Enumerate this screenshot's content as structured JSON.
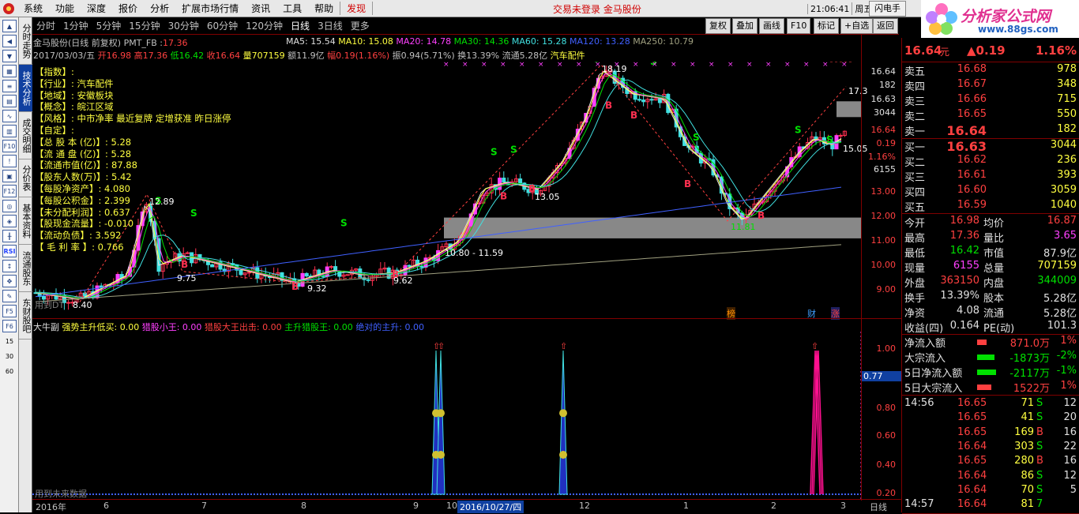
{
  "menu": [
    "系统",
    "功能",
    "深度",
    "报价",
    "分析",
    "扩展市场行情",
    "资讯",
    "工具",
    "帮助"
  ],
  "menu_find": "发现",
  "status_center": "交易未登录   金马股份",
  "clock": {
    "time": "21:06:41",
    "weekday": "周五"
  },
  "flash": "闪电手",
  "brand": {
    "name": "分析家公式网",
    "url": "www.88gs.com"
  },
  "vtabs": [
    "分时走势",
    "技术分析",
    "成交明细",
    "分价表",
    "基本资料",
    "流通股东",
    "东财股吧"
  ],
  "timeframes": [
    "分时",
    "1分钟",
    "5分钟",
    "15分钟",
    "30分钟",
    "60分钟",
    "120分钟",
    "日线",
    "3日线",
    "更多"
  ],
  "toolbar": [
    "复权",
    "叠加",
    "画线",
    "F10",
    "标记",
    "+自选",
    "返回"
  ],
  "info": {
    "title": "金马股份(日线 前复权) PMT_FB :",
    "title_val": "17.36",
    "ma": [
      {
        "l": "MA5: 15.54",
        "c": "#e0e0e0"
      },
      {
        "l": "MA10: 15.08",
        "c": "#ffff40"
      },
      {
        "l": "MA20: 14.78",
        "c": "#ff40ff"
      },
      {
        "l": "MA30: 14.36",
        "c": "#00e000"
      },
      {
        "l": "MA60: 15.28",
        "c": "#40e0e0"
      },
      {
        "l": "MA120: 13.28",
        "c": "#4060ff"
      },
      {
        "l": "MA250: 10.79",
        "c": "#a0a080"
      }
    ],
    "line2": [
      {
        "t": "2017/03/03/五 ",
        "c": "#c0c0c0"
      },
      {
        "t": "开16.98 ",
        "c": "#ff4040"
      },
      {
        "t": "高17.36 ",
        "c": "#ff4040"
      },
      {
        "t": "低16.42 ",
        "c": "#00e000"
      },
      {
        "t": "收16.64 ",
        "c": "#ff4040"
      },
      {
        "t": "量707159 ",
        "c": "#ffff40"
      },
      {
        "t": "额11.9亿 ",
        "c": "#c0c0c0"
      },
      {
        "t": "幅0.19(1.16%) ",
        "c": "#ff4040"
      },
      {
        "t": "振0.94(5.71%) ",
        "c": "#c0c0c0"
      },
      {
        "t": "换13.39% ",
        "c": "#c0c0c0"
      },
      {
        "t": "流通5.28亿 ",
        "c": "#c0c0c0"
      },
      {
        "t": "汽车配件",
        "c": "#ffff40"
      }
    ]
  },
  "fin": [
    "【指数】:",
    "【行业】: 汽车配件",
    "【地域】: 安徽板块",
    "【概念】: 皖江区域",
    "【风格】: 中市净率 最近复牌 定增获准 昨日涨停",
    "【自定】:",
    "【总 股 本 (亿)】: 5.28",
    "【流 通 盘 (亿)】: 5.28",
    "【流通市值(亿)】: 87.88",
    "【股东人数(万)】: 5.42",
    "【每股净资产】: 4.080",
    "【每股公积金】: 2.399",
    "【未分配利润】: 0.637",
    "【股现金流量】: -0.010",
    "【流动负债】: 3.592",
    "【 毛 利 率 】: 0.766"
  ],
  "chart_labels": {
    "p1289": "12.89",
    "p975": "9.75",
    "p932": "9.32",
    "p962": "9.62",
    "p1080": "10.80 - 11.59",
    "p1305": "13.05",
    "p1819": "18.19",
    "p1181": "11.81",
    "p1505": "15.05",
    "p173": "17.3",
    "p840": "8.40",
    "use": "用到DT",
    "future": "用到未来数据"
  },
  "price_axis": [
    "16.64",
    "182",
    "16.63",
    "3044",
    "16.64",
    "0.19",
    "1.16%",
    "6155",
    "13.00",
    "12.00",
    "11.00",
    "10.00",
    "9.00"
  ],
  "sub_axis": [
    "1.00",
    "0.80",
    "0.77",
    "0.60",
    "0.40",
    "0.20"
  ],
  "legend": [
    {
      "t": "大牛副 ",
      "c": "#e0e0e0"
    },
    {
      "t": "强势主升低买: 0.00  ",
      "c": "#ffff40"
    },
    {
      "t": "猎股小王: 0.00  ",
      "c": "#ff40ff"
    },
    {
      "t": "猎股大王出击: 0.00  ",
      "c": "#ff4040"
    },
    {
      "t": "主升猎股王: 0.00  ",
      "c": "#00e000"
    },
    {
      "t": "绝对的主升: 0.00",
      "c": "#4060ff"
    }
  ],
  "xaxis": [
    "2016年",
    "6",
    "7",
    "8",
    "9",
    "10",
    "2016/10/27/四",
    "12",
    "1",
    "2",
    "3",
    "日线"
  ],
  "events": [
    "榜",
    "财",
    "涨"
  ],
  "quote": {
    "price": "16.64",
    "unit": "元",
    "chg": "▲0.19",
    "pct": "1.16%"
  },
  "asks": [
    {
      "l": "卖五",
      "p": "16.68",
      "v": "978"
    },
    {
      "l": "卖四",
      "p": "16.67",
      "v": "348"
    },
    {
      "l": "卖三",
      "p": "16.66",
      "v": "715"
    },
    {
      "l": "卖二",
      "p": "16.65",
      "v": "550"
    },
    {
      "l": "卖一",
      "p": "16.64",
      "v": "182"
    }
  ],
  "bids": [
    {
      "l": "买一",
      "p": "16.63",
      "v": "3044"
    },
    {
      "l": "买二",
      "p": "16.62",
      "v": "236"
    },
    {
      "l": "买三",
      "p": "16.61",
      "v": "393"
    },
    {
      "l": "买四",
      "p": "16.60",
      "v": "3059"
    },
    {
      "l": "买五",
      "p": "16.59",
      "v": "1040"
    }
  ],
  "stats": [
    [
      "今开",
      "16.98",
      "均价",
      "16.87"
    ],
    [
      "最高",
      "17.36",
      "量比",
      "3.65"
    ],
    [
      "最低",
      "16.42",
      "市值",
      "87.9亿"
    ],
    [
      "现量",
      "6155",
      "总量",
      "707159"
    ],
    [
      "外盘",
      "363150",
      "内盘",
      "344009"
    ],
    [
      "换手",
      "13.39%",
      "股本",
      "5.28亿"
    ],
    [
      "净资",
      "4.08",
      "流通",
      "5.28亿"
    ],
    [
      "收益(四)",
      "0.164",
      "PE(动)",
      "101.3"
    ]
  ],
  "flows": [
    {
      "l": "净流入额",
      "v": "871.0万",
      "p": "1%"
    },
    {
      "l": "大宗流入",
      "v": "-1873万",
      "p": "-2%"
    },
    {
      "l": "5日净流入额",
      "v": "-2117万",
      "p": "-1%"
    },
    {
      "l": "5日大宗流入",
      "v": "1522万",
      "p": "1%"
    }
  ],
  "ticks": [
    {
      "t": "14:56",
      "p": "16.65",
      "v": "71",
      "d": "S",
      "n": "12"
    },
    {
      "t": "",
      "p": "16.65",
      "v": "41",
      "d": "S",
      "n": "20"
    },
    {
      "t": "",
      "p": "16.65",
      "v": "169",
      "d": "B",
      "n": "16"
    },
    {
      "t": "",
      "p": "16.64",
      "v": "303",
      "d": "S",
      "n": "22"
    },
    {
      "t": "",
      "p": "16.65",
      "v": "280",
      "d": "B",
      "n": "16"
    },
    {
      "t": "",
      "p": "16.64",
      "v": "86",
      "d": "S",
      "n": "12"
    },
    {
      "t": "",
      "p": "16.64",
      "v": "70",
      "d": "S",
      "n": "5"
    },
    {
      "t": "14:57",
      "p": "16.64",
      "v": "81",
      "d": "7",
      "n": ""
    }
  ],
  "left_nums": [
    "15",
    "30",
    "60"
  ]
}
